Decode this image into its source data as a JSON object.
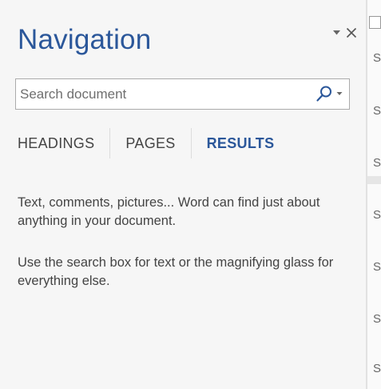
{
  "nav_pane": {
    "title": "Navigation",
    "search": {
      "placeholder": "Search document",
      "value": ""
    },
    "tabs": [
      {
        "label": "HEADINGS",
        "active": false
      },
      {
        "label": "PAGES",
        "active": false
      },
      {
        "label": "RESULTS",
        "active": true
      }
    ],
    "messages": [
      "Text, comments, pictures... Word can find just about anything in your document.",
      "Use the search box for text or the magnifying glass for everything else."
    ]
  },
  "doc_edge_chars": [
    "S",
    "S",
    "S",
    "S",
    "S",
    "S",
    "S"
  ],
  "colors": {
    "accent": "#2b579a",
    "text": "#444444",
    "pane_bg": "#f6f6f6"
  },
  "icons": [
    "chevron-down-icon",
    "close-icon",
    "magnifier-icon"
  ]
}
